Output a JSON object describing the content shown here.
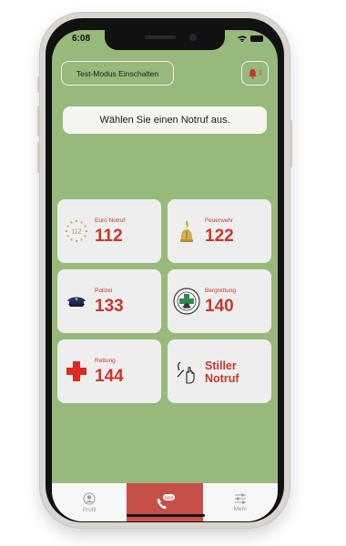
{
  "status": {
    "time": "6:08"
  },
  "header": {
    "test_mode_label": "Test-Modus Einschalten",
    "bell_count": "1"
  },
  "prompt": "Wählen Sie einen Notruf aus.",
  "cards": [
    {
      "label": "Euro Notruf",
      "number": "112",
      "icon": "euro-stars-icon",
      "icon_text": "112"
    },
    {
      "label": "Feuerwehr",
      "number": "122",
      "icon": "fire-helmet-icon"
    },
    {
      "label": "Polizei",
      "number": "133",
      "icon": "police-cap-icon"
    },
    {
      "label": "Bergrettung",
      "number": "140",
      "icon": "mountain-rescue-icon"
    },
    {
      "label": "Rettung",
      "number": "144",
      "icon": "red-cross-icon"
    },
    {
      "label": "",
      "number": "Stiller Notruf",
      "icon": "silent-hand-icon"
    }
  ],
  "tabs": [
    {
      "label": "Profil",
      "icon": "profile-icon"
    },
    {
      "label": "",
      "icon": "sos-phone-icon",
      "badge": "SOS"
    },
    {
      "label": "Mehr",
      "icon": "sliders-icon"
    }
  ],
  "colors": {
    "background": "#97b97c",
    "accent": "#c8382a",
    "sos": "#c65047"
  }
}
